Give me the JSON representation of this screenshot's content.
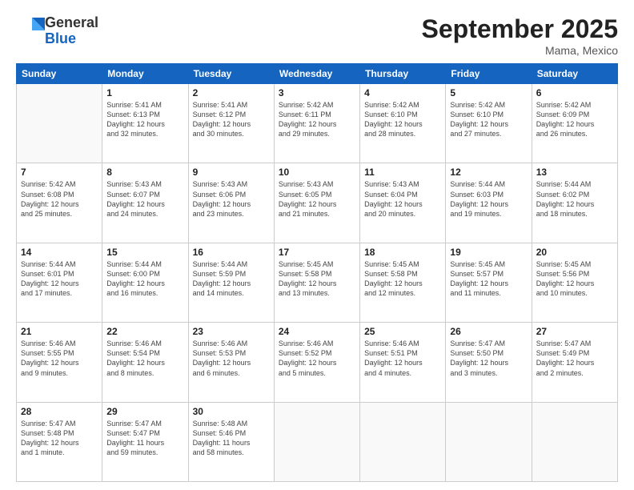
{
  "logo": {
    "general": "General",
    "blue": "Blue"
  },
  "header": {
    "month": "September 2025",
    "location": "Mama, Mexico"
  },
  "weekdays": [
    "Sunday",
    "Monday",
    "Tuesday",
    "Wednesday",
    "Thursday",
    "Friday",
    "Saturday"
  ],
  "weeks": [
    [
      {
        "day": "",
        "info": ""
      },
      {
        "day": "1",
        "info": "Sunrise: 5:41 AM\nSunset: 6:13 PM\nDaylight: 12 hours\nand 32 minutes."
      },
      {
        "day": "2",
        "info": "Sunrise: 5:41 AM\nSunset: 6:12 PM\nDaylight: 12 hours\nand 30 minutes."
      },
      {
        "day": "3",
        "info": "Sunrise: 5:42 AM\nSunset: 6:11 PM\nDaylight: 12 hours\nand 29 minutes."
      },
      {
        "day": "4",
        "info": "Sunrise: 5:42 AM\nSunset: 6:10 PM\nDaylight: 12 hours\nand 28 minutes."
      },
      {
        "day": "5",
        "info": "Sunrise: 5:42 AM\nSunset: 6:10 PM\nDaylight: 12 hours\nand 27 minutes."
      },
      {
        "day": "6",
        "info": "Sunrise: 5:42 AM\nSunset: 6:09 PM\nDaylight: 12 hours\nand 26 minutes."
      }
    ],
    [
      {
        "day": "7",
        "info": "Sunrise: 5:42 AM\nSunset: 6:08 PM\nDaylight: 12 hours\nand 25 minutes."
      },
      {
        "day": "8",
        "info": "Sunrise: 5:43 AM\nSunset: 6:07 PM\nDaylight: 12 hours\nand 24 minutes."
      },
      {
        "day": "9",
        "info": "Sunrise: 5:43 AM\nSunset: 6:06 PM\nDaylight: 12 hours\nand 23 minutes."
      },
      {
        "day": "10",
        "info": "Sunrise: 5:43 AM\nSunset: 6:05 PM\nDaylight: 12 hours\nand 21 minutes."
      },
      {
        "day": "11",
        "info": "Sunrise: 5:43 AM\nSunset: 6:04 PM\nDaylight: 12 hours\nand 20 minutes."
      },
      {
        "day": "12",
        "info": "Sunrise: 5:44 AM\nSunset: 6:03 PM\nDaylight: 12 hours\nand 19 minutes."
      },
      {
        "day": "13",
        "info": "Sunrise: 5:44 AM\nSunset: 6:02 PM\nDaylight: 12 hours\nand 18 minutes."
      }
    ],
    [
      {
        "day": "14",
        "info": "Sunrise: 5:44 AM\nSunset: 6:01 PM\nDaylight: 12 hours\nand 17 minutes."
      },
      {
        "day": "15",
        "info": "Sunrise: 5:44 AM\nSunset: 6:00 PM\nDaylight: 12 hours\nand 16 minutes."
      },
      {
        "day": "16",
        "info": "Sunrise: 5:44 AM\nSunset: 5:59 PM\nDaylight: 12 hours\nand 14 minutes."
      },
      {
        "day": "17",
        "info": "Sunrise: 5:45 AM\nSunset: 5:58 PM\nDaylight: 12 hours\nand 13 minutes."
      },
      {
        "day": "18",
        "info": "Sunrise: 5:45 AM\nSunset: 5:58 PM\nDaylight: 12 hours\nand 12 minutes."
      },
      {
        "day": "19",
        "info": "Sunrise: 5:45 AM\nSunset: 5:57 PM\nDaylight: 12 hours\nand 11 minutes."
      },
      {
        "day": "20",
        "info": "Sunrise: 5:45 AM\nSunset: 5:56 PM\nDaylight: 12 hours\nand 10 minutes."
      }
    ],
    [
      {
        "day": "21",
        "info": "Sunrise: 5:46 AM\nSunset: 5:55 PM\nDaylight: 12 hours\nand 9 minutes."
      },
      {
        "day": "22",
        "info": "Sunrise: 5:46 AM\nSunset: 5:54 PM\nDaylight: 12 hours\nand 8 minutes."
      },
      {
        "day": "23",
        "info": "Sunrise: 5:46 AM\nSunset: 5:53 PM\nDaylight: 12 hours\nand 6 minutes."
      },
      {
        "day": "24",
        "info": "Sunrise: 5:46 AM\nSunset: 5:52 PM\nDaylight: 12 hours\nand 5 minutes."
      },
      {
        "day": "25",
        "info": "Sunrise: 5:46 AM\nSunset: 5:51 PM\nDaylight: 12 hours\nand 4 minutes."
      },
      {
        "day": "26",
        "info": "Sunrise: 5:47 AM\nSunset: 5:50 PM\nDaylight: 12 hours\nand 3 minutes."
      },
      {
        "day": "27",
        "info": "Sunrise: 5:47 AM\nSunset: 5:49 PM\nDaylight: 12 hours\nand 2 minutes."
      }
    ],
    [
      {
        "day": "28",
        "info": "Sunrise: 5:47 AM\nSunset: 5:48 PM\nDaylight: 12 hours\nand 1 minute."
      },
      {
        "day": "29",
        "info": "Sunrise: 5:47 AM\nSunset: 5:47 PM\nDaylight: 11 hours\nand 59 minutes."
      },
      {
        "day": "30",
        "info": "Sunrise: 5:48 AM\nSunset: 5:46 PM\nDaylight: 11 hours\nand 58 minutes."
      },
      {
        "day": "",
        "info": ""
      },
      {
        "day": "",
        "info": ""
      },
      {
        "day": "",
        "info": ""
      },
      {
        "day": "",
        "info": ""
      }
    ]
  ]
}
